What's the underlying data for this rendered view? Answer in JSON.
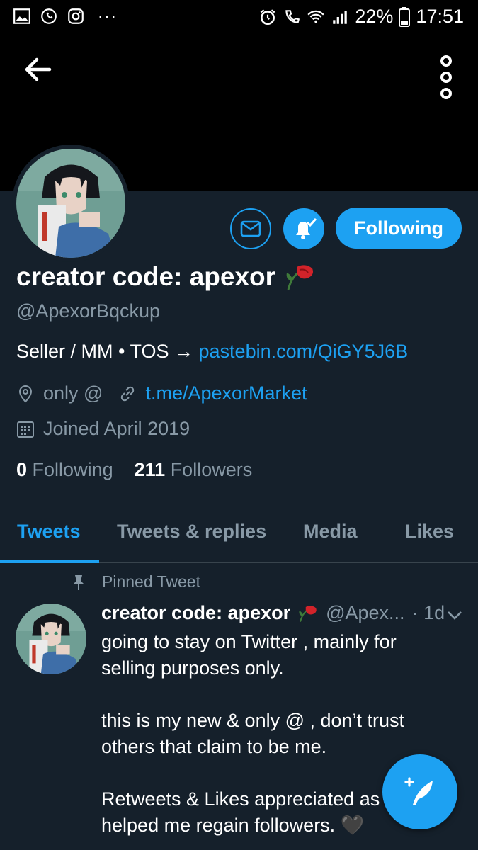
{
  "status_bar": {
    "battery": "22%",
    "time": "17:51",
    "more": "···"
  },
  "header": {
    "back_icon": "arrow-left-icon",
    "more_icon": "vertical-dots-icon"
  },
  "profile": {
    "name": "creator code: apexor",
    "handle": "@ApexorBqckup",
    "bio_text": "Seller / MM • TOS → ",
    "bio_link": "pastebin.com/QiGY5J6B",
    "location": "only @",
    "website": "t.me/ApexorMarket",
    "joined": "Joined April 2019",
    "following_count": "0",
    "following_label": "Following",
    "followers_count": "211",
    "followers_label": "Followers",
    "follow_button": "Following"
  },
  "tabs": [
    {
      "label": "Tweets",
      "active": true
    },
    {
      "label": "Tweets & replies",
      "active": false
    },
    {
      "label": "Media",
      "active": false
    },
    {
      "label": "Likes",
      "active": false
    }
  ],
  "tweet": {
    "pinned_label": "Pinned Tweet",
    "name": "creator code: apexor",
    "handle": "@Apex...",
    "time": "· 1d",
    "lines": [
      "going to stay on Twitter , mainly for selling purposes only.",
      "this is my new & only @ , don’t trust others that claim to be me.",
      "Retweets & Likes appreciated as",
      "helped me regain followers. 🖤"
    ]
  },
  "colors": {
    "background": "#15202b",
    "accent": "#1da1f2",
    "secondary_text": "#8899a6"
  }
}
